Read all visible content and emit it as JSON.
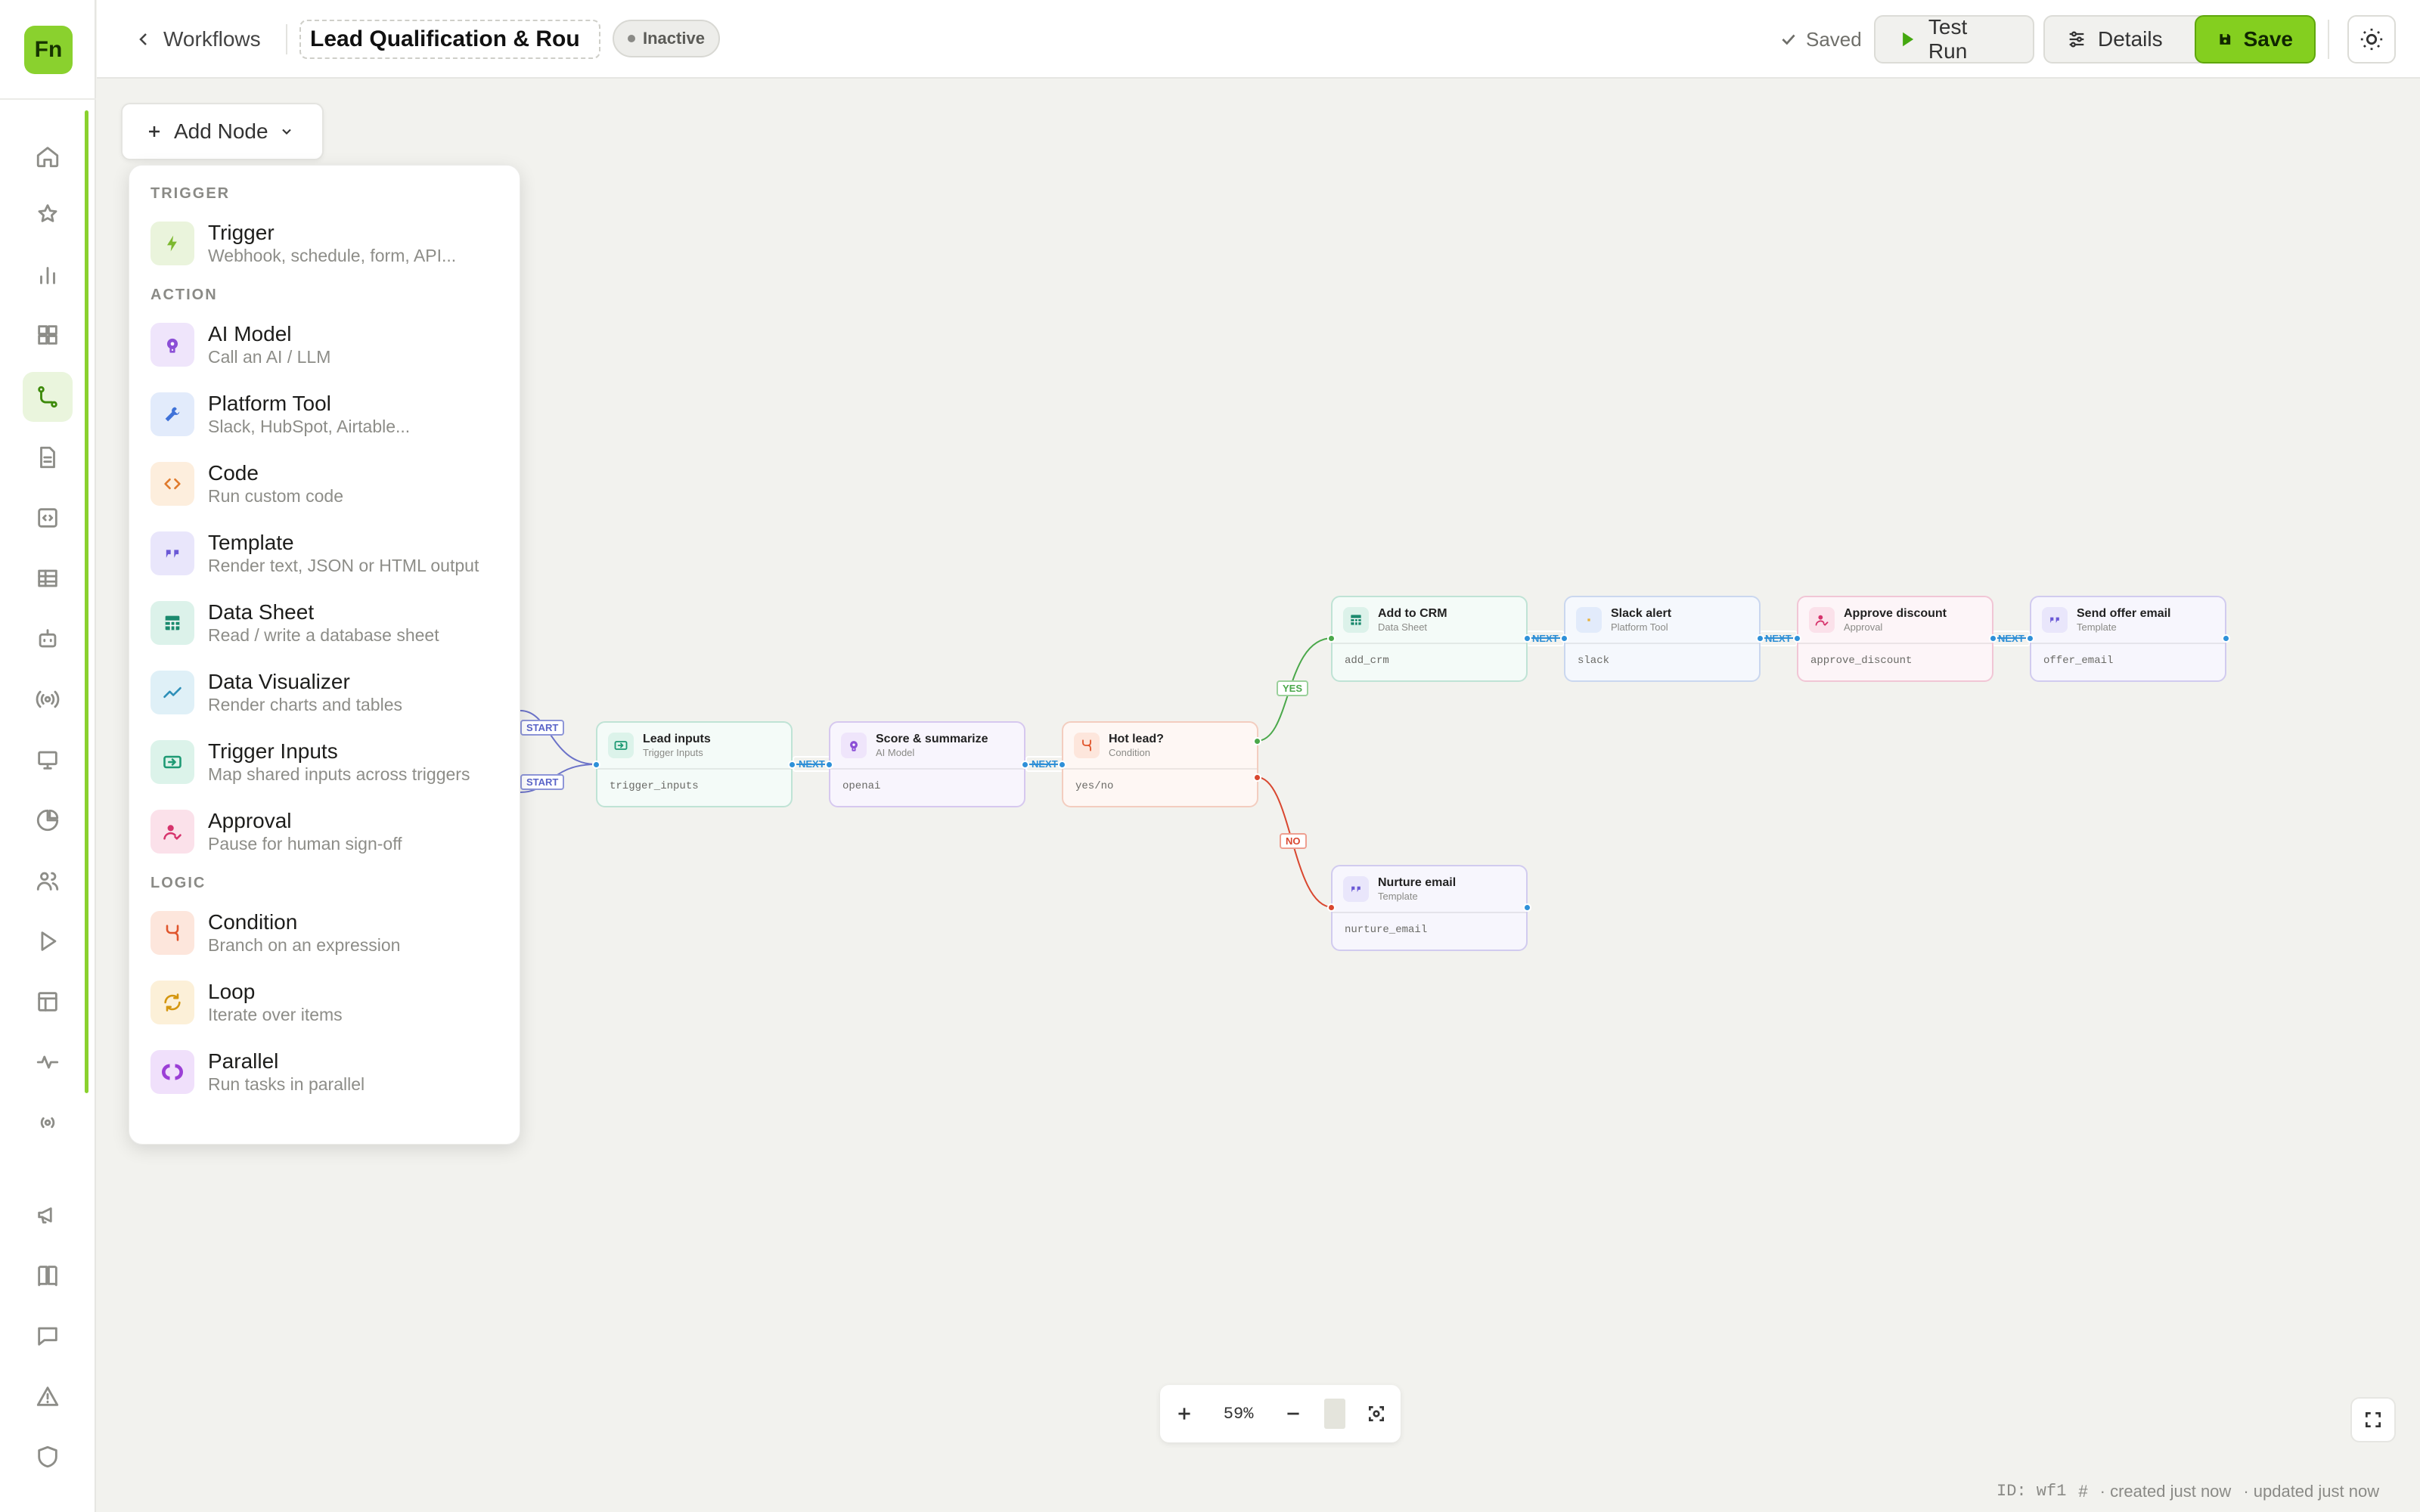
{
  "app": {
    "logo": "Fn"
  },
  "sidebar": {
    "items": [
      {
        "icon": "home-icon"
      },
      {
        "icon": "star-icon"
      },
      {
        "icon": "bar-chart-icon"
      },
      {
        "icon": "grid-icon"
      },
      {
        "icon": "workflow-icon",
        "active": true
      },
      {
        "icon": "document-icon"
      },
      {
        "icon": "code-file-icon"
      },
      {
        "icon": "table-icon"
      },
      {
        "icon": "bot-icon"
      },
      {
        "icon": "broadcast-icon"
      },
      {
        "icon": "monitor-icon"
      },
      {
        "icon": "pie-chart-icon"
      },
      {
        "icon": "users-icon"
      },
      {
        "icon": "play-icon"
      },
      {
        "icon": "layout-icon"
      },
      {
        "icon": "activity-icon"
      },
      {
        "icon": "radio-icon"
      },
      {
        "icon": "megaphone-icon"
      },
      {
        "icon": "book-icon"
      },
      {
        "icon": "chat-icon"
      },
      {
        "icon": "warning-icon"
      },
      {
        "icon": "shield-icon"
      }
    ]
  },
  "header": {
    "back_label": "Workflows",
    "workflow_title": "Lead Qualification & Rou",
    "status": "Inactive",
    "saved_label": "Saved",
    "test_run_label": "Test Run",
    "details_label": "Details",
    "save_label": "Save"
  },
  "add_node": {
    "label": "Add Node",
    "sections": [
      {
        "title": "TRIGGER",
        "items": [
          {
            "name": "Trigger",
            "desc": "Webhook, schedule, form, API...",
            "icon": "bolt-icon",
            "color": "#7cb82f",
            "bg": "#eaf4dc"
          }
        ]
      },
      {
        "title": "ACTION",
        "items": [
          {
            "name": "AI Model",
            "desc": "Call an AI / LLM",
            "icon": "brain-icon",
            "color": "#8b4fd6",
            "bg": "#efe5fb"
          },
          {
            "name": "Platform Tool",
            "desc": "Slack, HubSpot, Airtable...",
            "icon": "wrench-icon",
            "color": "#3f72d8",
            "bg": "#e2ebfb"
          },
          {
            "name": "Code",
            "desc": "Run custom code",
            "icon": "code-icon",
            "color": "#e07a2c",
            "bg": "#fdeedd"
          },
          {
            "name": "Template",
            "desc": "Render text, JSON or HTML output",
            "icon": "quote-icon",
            "color": "#6a58d6",
            "bg": "#e9e6fb"
          },
          {
            "name": "Data Sheet",
            "desc": "Read / write a database sheet",
            "icon": "sheet-icon",
            "color": "#1b8a6e",
            "bg": "#dcf2ea"
          },
          {
            "name": "Data Visualizer",
            "desc": "Render charts and tables",
            "icon": "trend-icon",
            "color": "#2d8fb8",
            "bg": "#dff0f7"
          },
          {
            "name": "Trigger Inputs",
            "desc": "Map shared inputs across triggers",
            "icon": "input-icon",
            "color": "#1e9a74",
            "bg": "#dcf3ea"
          },
          {
            "name": "Approval",
            "desc": "Pause for human sign-off",
            "icon": "user-check-icon",
            "color": "#d6336c",
            "bg": "#fbe1ea"
          }
        ]
      },
      {
        "title": "LOGIC",
        "items": [
          {
            "name": "Condition",
            "desc": "Branch on an expression",
            "icon": "branch-icon",
            "color": "#e0552c",
            "bg": "#fde6dc"
          },
          {
            "name": "Loop",
            "desc": "Iterate over items",
            "icon": "loop-icon",
            "color": "#d4960f",
            "bg": "#fcf0d8"
          },
          {
            "name": "Parallel",
            "desc": "Run tasks in parallel",
            "icon": "parallel-icon",
            "color": "#9b3fd6",
            "bg": "#f0e0fb"
          }
        ]
      }
    ]
  },
  "workflow": {
    "nodes": [
      {
        "id": "lead_inputs",
        "title": "Lead inputs",
        "type": "Trigger Inputs",
        "key": "trigger_inputs",
        "color": "#1e9a74",
        "bg": "#dcf3ea",
        "border": "#bfe3d5",
        "tint": "#f4fbf8",
        "icon": "input-icon"
      },
      {
        "id": "score",
        "title": "Score & summarize",
        "type": "AI Model",
        "key": "openai",
        "color": "#8b4fd6",
        "bg": "#efe5fb",
        "border": "#d6c8ef",
        "tint": "#f8f5fd",
        "icon": "brain-icon"
      },
      {
        "id": "hot",
        "title": "Hot lead?",
        "type": "Condition",
        "key": "yes/no",
        "color": "#e0552c",
        "bg": "#fde6dc",
        "border": "#f3cdbf",
        "tint": "#fef7f4",
        "icon": "branch-icon"
      },
      {
        "id": "crm",
        "title": "Add to CRM",
        "type": "Data Sheet",
        "key": "add_crm",
        "color": "#1b8a6e",
        "bg": "#dcf2ea",
        "border": "#bfe3d5",
        "tint": "#f4fbf8",
        "icon": "sheet-icon"
      },
      {
        "id": "slack",
        "title": "Slack alert",
        "type": "Platform Tool",
        "key": "slack",
        "color": "#3f72d8",
        "bg": "#e2ebfb",
        "border": "#cad7ef",
        "tint": "#f5f8fd",
        "icon": "slack-icon"
      },
      {
        "id": "approve",
        "title": "Approve discount",
        "type": "Approval",
        "key": "approve_discount",
        "color": "#d6336c",
        "bg": "#fbe1ea",
        "border": "#f1c6d5",
        "tint": "#fdf5f8",
        "icon": "user-check-icon"
      },
      {
        "id": "offer",
        "title": "Send offer email",
        "type": "Template",
        "key": "offer_email",
        "color": "#6a58d6",
        "bg": "#e9e6fb",
        "border": "#d1cbef",
        "tint": "#f7f6fd",
        "icon": "quote-icon"
      },
      {
        "id": "nurture",
        "title": "Nurture email",
        "type": "Template",
        "key": "nurture_email",
        "color": "#6a58d6",
        "bg": "#e9e6fb",
        "border": "#d1cbef",
        "tint": "#f7f6fd",
        "icon": "quote-icon"
      }
    ],
    "edge_labels": {
      "next": "NEXT",
      "start": "START",
      "yes": "YES",
      "no": "NO"
    }
  },
  "zoom": {
    "level": "59%"
  },
  "footer": {
    "id": "ID: wf1",
    "created": "· created just now",
    "updated": "· updated just now"
  }
}
